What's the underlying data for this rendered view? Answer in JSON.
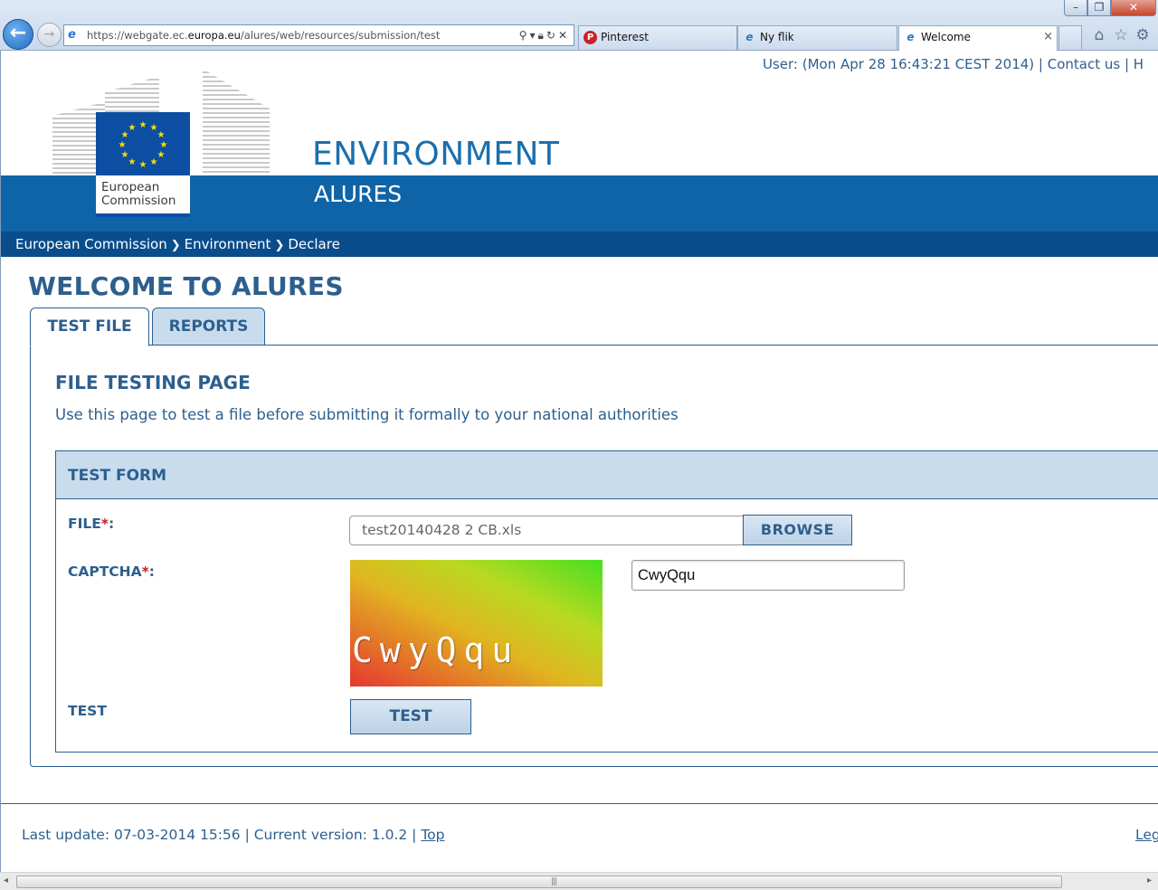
{
  "browser": {
    "url_prefix": "https://webgate.ec.",
    "url_domain": "europa.eu",
    "url_suffix": "/alures/web/resources/submission/test",
    "tabs": [
      {
        "label": "Pinterest"
      },
      {
        "label": "Ny flik"
      },
      {
        "label": "Welcome"
      }
    ]
  },
  "header": {
    "user_text": "User: (Mon Apr 28 16:43:21 CEST 2014) |",
    "contact": "Contact us",
    "separator_tail": "| H",
    "logo_line1": "European",
    "logo_line2": "Commission",
    "site_title": "ENVIRONMENT",
    "site_subtitle": "ALURES"
  },
  "breadcrumb": [
    "European Commission",
    "Environment",
    "Declare"
  ],
  "page": {
    "heading": "WELCOME TO ALURES",
    "tabs": [
      {
        "label": "TEST FILE",
        "active": true
      },
      {
        "label": "REPORTS",
        "active": false
      }
    ],
    "section_title": "FILE TESTING PAGE",
    "intro": "Use this page to test a file before submitting it formally to your national authorities"
  },
  "form": {
    "title": "TEST FORM",
    "file_label": "FILE",
    "file_value": "test20140428 2 CB.xls",
    "browse_label": "BROWSE",
    "captcha_label": "CAPTCHA",
    "required_mark": "*",
    "label_colon": ":",
    "captcha_image_text": "CwyQqu",
    "captcha_value": "CwyQqu",
    "test_label": "TEST",
    "test_button": "TEST"
  },
  "footer": {
    "text": "Last update: 07-03-2014 15:56 | Current version: 1.0.2 |",
    "top_link": "Top",
    "right_link": "Leg"
  },
  "colors": {
    "brand_blue": "#0e64a7",
    "text_blue": "#2d5f8e",
    "panel_bg": "#c8dcee",
    "required": "#c21d1d"
  }
}
